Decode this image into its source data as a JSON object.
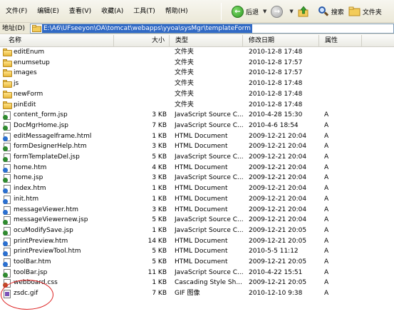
{
  "menu": [
    "文件(F)",
    "编辑(E)",
    "查看(V)",
    "收藏(A)",
    "工具(T)",
    "帮助(H)"
  ],
  "toolbar": {
    "back_label": "后退",
    "search_label": "搜索",
    "folders_label": "文件夹"
  },
  "address": {
    "label": "地址(D)",
    "value": "E:\\A6\\UFseeyon\\OA\\tomcat\\webapps\\yyoa\\sysMgr\\templateForm"
  },
  "columns": {
    "name": "名称",
    "size": "大小",
    "type": "类型",
    "date": "修改日期",
    "attr": "属性"
  },
  "files": [
    {
      "icon": "folder-icon",
      "name": "editEnum",
      "size": "",
      "type": "文件夹",
      "date": "2010-12-8 17:48",
      "attr": ""
    },
    {
      "icon": "folder-icon",
      "name": "enumsetup",
      "size": "",
      "type": "文件夹",
      "date": "2010-12-8 17:57",
      "attr": ""
    },
    {
      "icon": "folder-icon",
      "name": "images",
      "size": "",
      "type": "文件夹",
      "date": "2010-12-8 17:57",
      "attr": ""
    },
    {
      "icon": "folder-icon",
      "name": "js",
      "size": "",
      "type": "文件夹",
      "date": "2010-12-8 17:48",
      "attr": ""
    },
    {
      "icon": "folder-icon",
      "name": "newForm",
      "size": "",
      "type": "文件夹",
      "date": "2010-12-8 17:48",
      "attr": ""
    },
    {
      "icon": "folder-icon",
      "name": "pinEdit",
      "size": "",
      "type": "文件夹",
      "date": "2010-12-8 17:48",
      "attr": ""
    },
    {
      "icon": "jsp-file-icon",
      "name": "content_form.jsp",
      "size": "3 KB",
      "type": "JavaScript Source C...",
      "date": "2010-4-28 15:30",
      "attr": "A"
    },
    {
      "icon": "jsp-file-icon",
      "name": "DocMgrHome.jsp",
      "size": "7 KB",
      "type": "JavaScript Source C...",
      "date": "2010-4-6 18:54",
      "attr": "A"
    },
    {
      "icon": "html-file-icon",
      "name": "editMessageIframe.html",
      "size": "1 KB",
      "type": "HTML Document",
      "date": "2009-12-21 20:04",
      "attr": "A"
    },
    {
      "icon": "jsp-file-icon",
      "name": "formDesignerHelp.htm",
      "size": "3 KB",
      "type": "HTML Document",
      "date": "2009-12-21 20:04",
      "attr": "A"
    },
    {
      "icon": "jsp-file-icon",
      "name": "formTemplateDel.jsp",
      "size": "5 KB",
      "type": "JavaScript Source C...",
      "date": "2009-12-21 20:04",
      "attr": "A"
    },
    {
      "icon": "html-file-icon",
      "name": "home.htm",
      "size": "4 KB",
      "type": "HTML Document",
      "date": "2009-12-21 20:04",
      "attr": "A"
    },
    {
      "icon": "jsp-file-icon",
      "name": "home.jsp",
      "size": "3 KB",
      "type": "JavaScript Source C...",
      "date": "2009-12-21 20:04",
      "attr": "A"
    },
    {
      "icon": "html-file-icon",
      "name": "index.htm",
      "size": "1 KB",
      "type": "HTML Document",
      "date": "2009-12-21 20:04",
      "attr": "A"
    },
    {
      "icon": "html-file-icon",
      "name": "init.htm",
      "size": "1 KB",
      "type": "HTML Document",
      "date": "2009-12-21 20:04",
      "attr": "A"
    },
    {
      "icon": "html-file-icon",
      "name": "messageViewer.htm",
      "size": "3 KB",
      "type": "HTML Document",
      "date": "2009-12-21 20:04",
      "attr": "A"
    },
    {
      "icon": "jsp-file-icon",
      "name": "messageViewernew.jsp",
      "size": "5 KB",
      "type": "JavaScript Source C...",
      "date": "2009-12-21 20:04",
      "attr": "A"
    },
    {
      "icon": "jsp-file-icon",
      "name": "ocuModifySave.jsp",
      "size": "1 KB",
      "type": "JavaScript Source C...",
      "date": "2009-12-21 20:05",
      "attr": "A"
    },
    {
      "icon": "html-file-icon",
      "name": "printPreview.htm",
      "size": "14 KB",
      "type": "HTML Document",
      "date": "2009-12-21 20:05",
      "attr": "A"
    },
    {
      "icon": "html-file-icon",
      "name": "printPreviewTool.htm",
      "size": "5 KB",
      "type": "HTML Document",
      "date": "2010-5-5 11:12",
      "attr": "A"
    },
    {
      "icon": "html-file-icon",
      "name": "toolBar.htm",
      "size": "5 KB",
      "type": "HTML Document",
      "date": "2009-12-21 20:05",
      "attr": "A"
    },
    {
      "icon": "jsp-file-icon",
      "name": "toolBar.jsp",
      "size": "11 KB",
      "type": "JavaScript Source C...",
      "date": "2010-4-22 15:51",
      "attr": "A"
    },
    {
      "icon": "css-file-icon",
      "name": "webboard.css",
      "size": "1 KB",
      "type": "Cascading Style Sh...",
      "date": "2009-12-21 20:05",
      "attr": "A"
    },
    {
      "icon": "gif-file-icon",
      "name": "zsdc.gif",
      "size": "7 KB",
      "type": "GIF 图像",
      "date": "2010-12-10 9:38",
      "attr": "A"
    }
  ]
}
